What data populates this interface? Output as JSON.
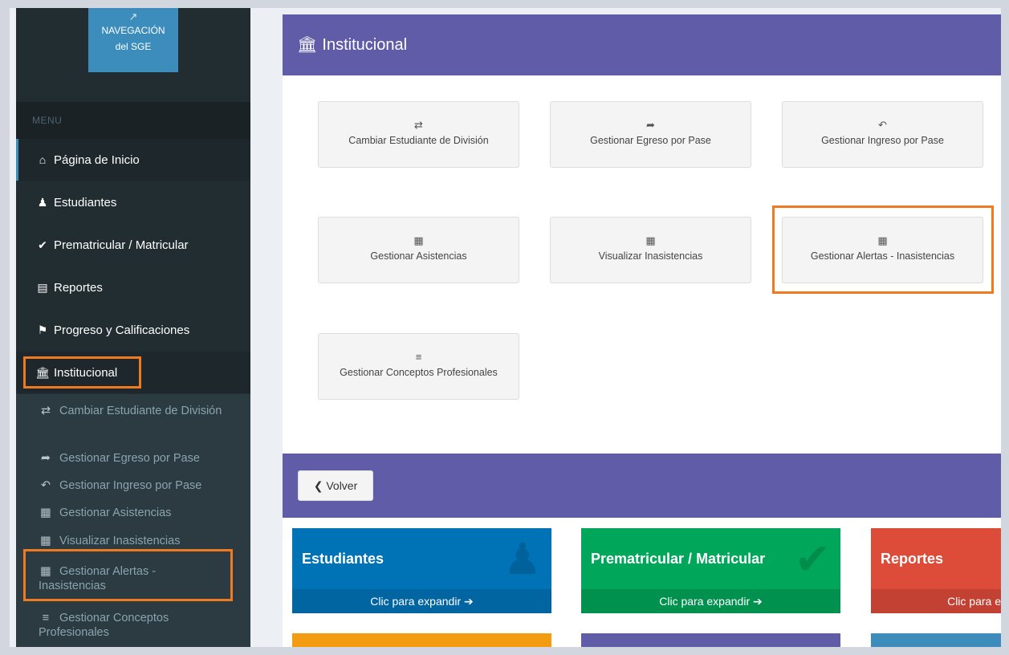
{
  "sidebar": {
    "sge_button": {
      "line1": "NAVEGACIÓN",
      "line2": "del SGE"
    },
    "menu_header": "MENU",
    "items": [
      {
        "label": "Página de Inicio",
        "icon": "home-icon"
      },
      {
        "label": "Estudiantes",
        "icon": "student-icon"
      },
      {
        "label": "Prematricular / Matricular",
        "icon": "check-icon"
      },
      {
        "label": "Reportes",
        "icon": "document-icon"
      },
      {
        "label": "Progreso y Calificaciones",
        "icon": "flag-icon"
      },
      {
        "label": "Institucional",
        "icon": "bank-icon"
      }
    ],
    "submenu": [
      {
        "label": "Cambiar Estudiante de División",
        "icon": "retweet-icon"
      },
      {
        "label": "Gestionar Egreso por Pase",
        "icon": "share-icon"
      },
      {
        "label": "Gestionar Ingreso por Pase",
        "icon": "reply-icon"
      },
      {
        "label": "Gestionar Asistencias",
        "icon": "calendar-icon"
      },
      {
        "label": "Visualizar Inasistencias",
        "icon": "calendar-icon"
      },
      {
        "label": "Gestionar Alertas - Inasistencias",
        "icon": "calendar-icon"
      },
      {
        "label": "Gestionar Conceptos Profesionales",
        "icon": "list-icon"
      }
    ]
  },
  "main": {
    "title": "Institucional",
    "tiles": [
      {
        "label": "Cambiar Estudiante de División",
        "icon": "retweet-icon"
      },
      {
        "label": "Gestionar Egreso por Pase",
        "icon": "share-icon"
      },
      {
        "label": "Gestionar Ingreso por Pase",
        "icon": "reply-icon"
      },
      {
        "label": "Gestionar Asistencias",
        "icon": "calendar-icon"
      },
      {
        "label": "Visualizar Inasistencias",
        "icon": "calendar-icon"
      },
      {
        "label": "Gestionar Alertas - Inasistencias",
        "icon": "calendar-icon"
      },
      {
        "label": "Gestionar Conceptos Profesionales",
        "icon": "list-icon"
      }
    ],
    "back_button": "Volver",
    "boxes": [
      {
        "title": "Estudiantes",
        "footer": "Clic para expandir",
        "color": "#0073b7"
      },
      {
        "title": "Prematricular / Matricular",
        "footer": "Clic para expandir",
        "color": "#00a65a"
      },
      {
        "title": "Reportes",
        "footer": "Clic para e",
        "color": "#dd4b39"
      }
    ],
    "bottom_box_colors": [
      "#f39c12",
      "#605ca8",
      "#3c8dbc"
    ]
  },
  "colors": {
    "sidebar_bg": "#222d32",
    "header_purple": "#605ca8",
    "highlight_orange": "#f07a1f"
  }
}
